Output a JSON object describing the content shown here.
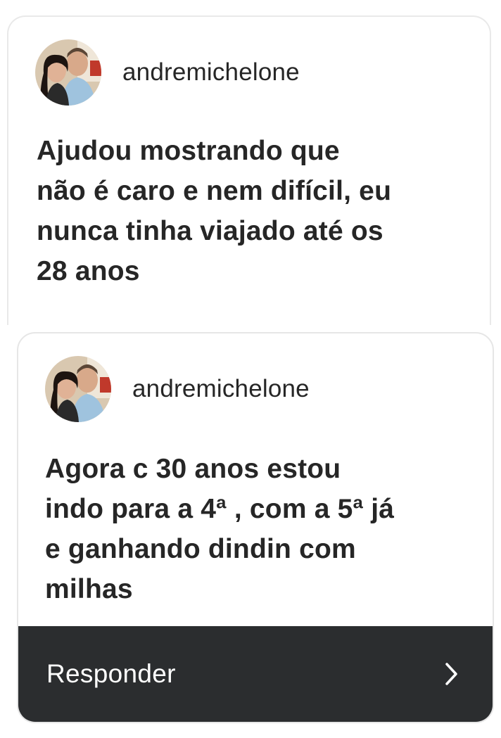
{
  "card1": {
    "username": "andremichelone",
    "message_lines": [
      "Ajudou mostrando que",
      "não é caro e nem difícil, eu",
      "nunca tinha viajado até os",
      "28 anos"
    ]
  },
  "card2": {
    "username": "andremichelone",
    "message_lines": [
      "Agora c 30 anos estou",
      "indo para a 4ª , com a 5ª já",
      "e ganhando dindin com",
      "milhas"
    ]
  },
  "reply": {
    "label": "Responder",
    "icon": "chevron-right-icon"
  },
  "colors": {
    "text": "#262626",
    "reply_bar": "#2b2d2f",
    "card_border": "#e9e9e9"
  }
}
